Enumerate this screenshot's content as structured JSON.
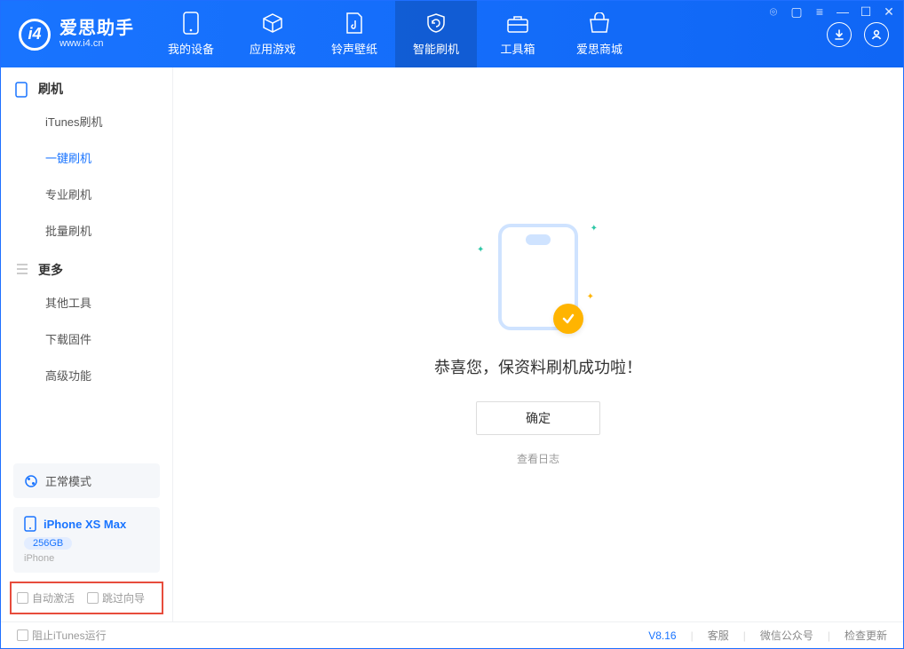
{
  "app": {
    "name_cn": "爱思助手",
    "url": "www.i4.cn"
  },
  "tabs": {
    "device": "我的设备",
    "apps": "应用游戏",
    "ringtones": "铃声壁纸",
    "flash": "智能刷机",
    "tools": "工具箱",
    "shop": "爱思商城"
  },
  "sidebar": {
    "group_flash": "刷机",
    "items_flash": {
      "itunes": "iTunes刷机",
      "oneclick": "一键刷机",
      "pro": "专业刷机",
      "batch": "批量刷机"
    },
    "group_more": "更多",
    "items_more": {
      "other": "其他工具",
      "download": "下载固件",
      "advanced": "高级功能"
    },
    "mode_label": "正常模式",
    "device": {
      "name": "iPhone XS Max",
      "storage": "256GB",
      "type": "iPhone"
    },
    "opts": {
      "auto_activate": "自动激活",
      "skip_guide": "跳过向导"
    }
  },
  "main": {
    "success": "恭喜您，保资料刷机成功啦！",
    "confirm": "确定",
    "view_log": "查看日志"
  },
  "footer": {
    "block_itunes": "阻止iTunes运行",
    "version": "V8.16",
    "support": "客服",
    "wechat": "微信公众号",
    "update": "检查更新"
  }
}
